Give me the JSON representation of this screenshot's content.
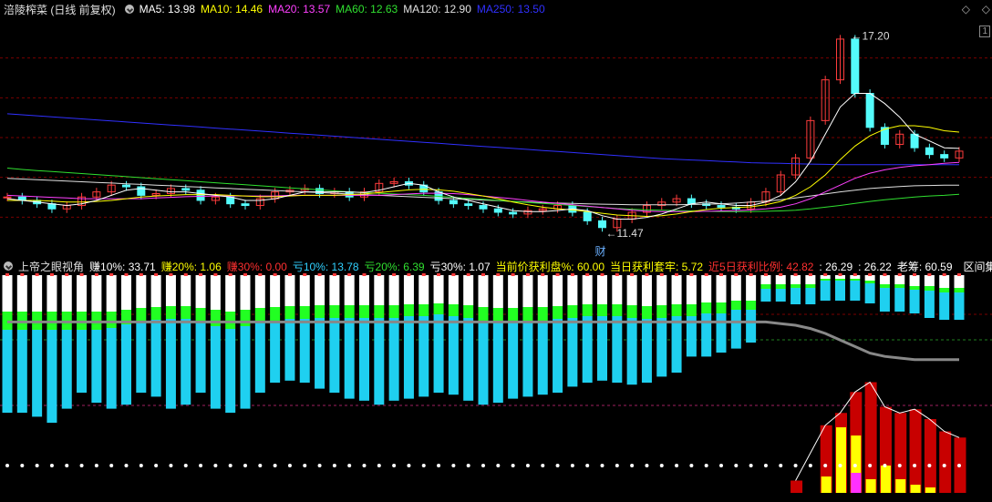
{
  "main_header": {
    "title": "涪陵榨菜 (日线 前复权)",
    "ma": [
      {
        "label": "MA5: 13.98",
        "color": "#ffffff"
      },
      {
        "label": "MA10: 14.46",
        "color": "#ffff00"
      },
      {
        "label": "MA20: 13.57",
        "color": "#ff40ff"
      },
      {
        "label": "MA60: 12.63",
        "color": "#30e030"
      },
      {
        "label": "MA120: 12.90",
        "color": "#e0e0e0"
      },
      {
        "label": "MA250: 13.50",
        "color": "#3030ff"
      }
    ]
  },
  "annotations": {
    "high": "17.20",
    "low": "11.47",
    "finance_mark": "财"
  },
  "right_controls": {
    "diamond": "◇",
    "box": "1"
  },
  "indicator_header": {
    "name": "上帝之眼视角",
    "items": [
      {
        "label": "赚10%: 33.71",
        "color": "#ffffff"
      },
      {
        "label": "赚20%: 1.06",
        "color": "#ffff00"
      },
      {
        "label": "赚30%: 0.00",
        "color": "#ff3030"
      },
      {
        "label": "亏10%: 13.78",
        "color": "#30d0ff"
      },
      {
        "label": "亏20%: 6.39",
        "color": "#30e030"
      },
      {
        "label": "亏30%: 1.07",
        "color": "#ffffff"
      },
      {
        "label": "当前价获利盘%: 60.00",
        "color": "#ffff00"
      },
      {
        "label": "当日获利套牢: 5.72",
        "color": "#ffff00"
      },
      {
        "label": "近5日获利比例: 42.82",
        "color": "#ff3030"
      },
      {
        "label": ": 26.29",
        "color": "#ffffff"
      },
      {
        "label": ": 26.22",
        "color": "#ffffff"
      },
      {
        "label": "老筹: 60.59",
        "color": "#ffffff"
      }
    ],
    "section_button": "区间集"
  },
  "colors": {
    "up": "#ff3c3c",
    "down": "#54fcfc",
    "grid": "#7a0000",
    "white_bar": "#ffffff",
    "green_bar": "#22ff22",
    "cyan_bar": "#1fd0f0",
    "red_bar": "#c80000",
    "yellow_bar": "#ffff00",
    "magenta_bar": "#ff30ff"
  },
  "chart_data": {
    "type": "candlestick",
    "ylim": [
      11.0,
      17.6
    ],
    "closes": [
      12.55,
      12.45,
      12.35,
      12.2,
      12.3,
      12.55,
      12.7,
      12.9,
      12.85,
      12.6,
      12.65,
      12.8,
      12.75,
      12.45,
      12.55,
      12.35,
      12.3,
      12.5,
      12.7,
      12.75,
      12.8,
      12.65,
      12.7,
      12.55,
      12.7,
      12.95,
      13.0,
      12.9,
      12.7,
      12.45,
      12.35,
      12.3,
      12.2,
      12.1,
      12.05,
      12.15,
      12.2,
      12.3,
      12.1,
      11.85,
      11.65,
      11.9,
      12.1,
      12.3,
      12.4,
      12.5,
      12.35,
      12.3,
      12.25,
      12.2,
      12.4,
      12.7,
      13.2,
      13.7,
      14.8,
      16.0,
      17.2,
      15.6,
      14.6,
      14.1,
      14.4,
      14.0,
      13.8,
      13.7,
      13.9
    ],
    "ma5": [
      12.5,
      12.45,
      12.4,
      12.35,
      12.3,
      12.35,
      12.45,
      12.6,
      12.75,
      12.8,
      12.75,
      12.7,
      12.7,
      12.65,
      12.6,
      12.55,
      12.45,
      12.45,
      12.5,
      12.6,
      12.7,
      12.7,
      12.7,
      12.7,
      12.68,
      12.75,
      12.85,
      12.95,
      12.9,
      12.7,
      12.55,
      12.45,
      12.35,
      12.25,
      12.15,
      12.12,
      12.12,
      12.15,
      12.2,
      12.15,
      12.0,
      11.9,
      11.9,
      11.95,
      12.05,
      12.2,
      12.35,
      12.4,
      12.35,
      12.3,
      12.3,
      12.4,
      12.6,
      13.0,
      13.6,
      14.4,
      15.2,
      15.6,
      15.6,
      15.3,
      14.9,
      14.4,
      14.2,
      14.0,
      13.98
    ],
    "ma10": [
      12.45,
      12.45,
      12.45,
      12.43,
      12.4,
      12.4,
      12.42,
      12.45,
      12.5,
      12.55,
      12.58,
      12.6,
      12.62,
      12.62,
      12.62,
      12.6,
      12.58,
      12.56,
      12.56,
      12.58,
      12.6,
      12.6,
      12.6,
      12.62,
      12.64,
      12.68,
      12.72,
      12.76,
      12.78,
      12.76,
      12.72,
      12.65,
      12.58,
      12.5,
      12.4,
      12.32,
      12.25,
      12.2,
      12.17,
      12.12,
      12.07,
      12.02,
      12.0,
      11.98,
      12.0,
      12.05,
      12.12,
      12.18,
      12.22,
      12.24,
      12.26,
      12.32,
      12.42,
      12.6,
      12.85,
      13.2,
      13.65,
      14.05,
      14.35,
      14.55,
      14.65,
      14.65,
      14.6,
      14.5,
      14.46
    ],
    "ma20": [
      12.6,
      12.58,
      12.56,
      12.54,
      12.52,
      12.5,
      12.5,
      12.5,
      12.5,
      12.5,
      12.52,
      12.54,
      12.56,
      12.57,
      12.58,
      12.58,
      12.58,
      12.58,
      12.58,
      12.6,
      12.6,
      12.6,
      12.6,
      12.6,
      12.6,
      12.6,
      12.62,
      12.64,
      12.66,
      12.66,
      12.65,
      12.62,
      12.58,
      12.54,
      12.5,
      12.45,
      12.4,
      12.36,
      12.32,
      12.28,
      12.24,
      12.2,
      12.16,
      12.13,
      12.12,
      12.12,
      12.12,
      12.13,
      12.14,
      12.15,
      12.17,
      12.2,
      12.25,
      12.35,
      12.5,
      12.7,
      12.9,
      13.1,
      13.25,
      13.35,
      13.42,
      13.47,
      13.5,
      13.54,
      13.57
    ],
    "ma60": [
      13.4,
      13.36,
      13.33,
      13.3,
      13.27,
      13.24,
      13.21,
      13.18,
      13.15,
      13.12,
      13.09,
      13.06,
      13.03,
      13.0,
      12.97,
      12.94,
      12.91,
      12.88,
      12.85,
      12.82,
      12.79,
      12.76,
      12.73,
      12.7,
      12.68,
      12.66,
      12.64,
      12.62,
      12.6,
      12.57,
      12.54,
      12.51,
      12.48,
      12.45,
      12.42,
      12.39,
      12.36,
      12.33,
      12.3,
      12.27,
      12.24,
      12.21,
      12.19,
      12.17,
      12.16,
      12.15,
      12.14,
      12.13,
      12.12,
      12.12,
      12.12,
      12.13,
      12.14,
      12.16,
      12.2,
      12.25,
      12.3,
      12.36,
      12.42,
      12.47,
      12.51,
      12.55,
      12.58,
      12.6,
      12.63
    ],
    "ma120": [
      13.1,
      13.08,
      13.06,
      13.04,
      13.02,
      13.0,
      12.98,
      12.96,
      12.94,
      12.92,
      12.9,
      12.88,
      12.86,
      12.84,
      12.82,
      12.8,
      12.78,
      12.76,
      12.74,
      12.72,
      12.7,
      12.68,
      12.66,
      12.64,
      12.62,
      12.6,
      12.58,
      12.56,
      12.54,
      12.52,
      12.5,
      12.48,
      12.46,
      12.44,
      12.42,
      12.4,
      12.38,
      12.37,
      12.36,
      12.35,
      12.34,
      12.33,
      12.32,
      12.32,
      12.32,
      12.32,
      12.33,
      12.34,
      12.35,
      12.37,
      12.4,
      12.43,
      12.47,
      12.52,
      12.58,
      12.64,
      12.7,
      12.75,
      12.8,
      12.83,
      12.86,
      12.88,
      12.89,
      12.9,
      12.9
    ],
    "ma250": [
      15.0,
      14.97,
      14.94,
      14.91,
      14.88,
      14.85,
      14.82,
      14.79,
      14.76,
      14.73,
      14.7,
      14.67,
      14.64,
      14.61,
      14.58,
      14.55,
      14.52,
      14.49,
      14.46,
      14.43,
      14.4,
      14.37,
      14.34,
      14.31,
      14.28,
      14.25,
      14.22,
      14.19,
      14.16,
      14.13,
      14.1,
      14.07,
      14.04,
      14.01,
      13.98,
      13.95,
      13.92,
      13.89,
      13.86,
      13.83,
      13.8,
      13.77,
      13.74,
      13.71,
      13.68,
      13.66,
      13.64,
      13.62,
      13.6,
      13.58,
      13.56,
      13.55,
      13.54,
      13.53,
      13.52,
      13.51,
      13.5,
      13.5,
      13.5,
      13.5,
      13.5,
      13.5,
      13.5,
      13.5,
      13.5
    ]
  },
  "indicator_data": {
    "ylim": [
      0,
      100
    ],
    "white_top": [
      40,
      40,
      40,
      40,
      40,
      40,
      40,
      40,
      38,
      36,
      35,
      34,
      34,
      36,
      38,
      40,
      38,
      36,
      35,
      34,
      34,
      33,
      33,
      33,
      33,
      33,
      33,
      32,
      32,
      31,
      32,
      33,
      35,
      36,
      36,
      35,
      35,
      34,
      33,
      32,
      32,
      32,
      33,
      34,
      33,
      32,
      32,
      30,
      30,
      28,
      28,
      10,
      10,
      10,
      10,
      4,
      4,
      4,
      6,
      10,
      10,
      12,
      12,
      14,
      14
    ],
    "green_top": [
      20,
      20,
      20,
      20,
      20,
      20,
      20,
      18,
      16,
      15,
      14,
      14,
      14,
      16,
      18,
      19,
      18,
      16,
      15,
      14,
      14,
      14,
      14,
      14,
      14,
      14,
      14,
      13,
      13,
      12,
      13,
      14,
      15,
      16,
      16,
      15,
      15,
      14,
      14,
      13,
      13,
      13,
      14,
      14,
      14,
      13,
      13,
      12,
      12,
      10,
      10,
      5,
      5,
      4,
      4,
      2,
      2,
      2,
      3,
      4,
      4,
      4,
      5,
      5,
      5
    ],
    "cyan_bottom": [
      -40,
      -40,
      -42,
      -45,
      -38,
      -30,
      -35,
      -38,
      -36,
      -30,
      -32,
      -38,
      -36,
      -30,
      -38,
      -40,
      -38,
      -30,
      -25,
      -24,
      -25,
      -28,
      -30,
      -33,
      -34,
      -36,
      -34,
      -33,
      -32,
      -30,
      -31,
      -34,
      -36,
      -35,
      -33,
      -32,
      -31,
      -30,
      -27,
      -25,
      -24,
      -25,
      -26,
      -25,
      -22,
      -20,
      -12,
      -12,
      -10,
      -8,
      -5,
      0,
      0,
      0,
      0,
      0,
      0,
      0,
      0,
      0,
      0,
      0,
      0,
      0,
      0
    ],
    "cyan_top_late": [
      0,
      0,
      0,
      0,
      0,
      0,
      0,
      0,
      0,
      0,
      0,
      0,
      0,
      0,
      0,
      0,
      0,
      0,
      0,
      0,
      0,
      0,
      0,
      0,
      0,
      0,
      0,
      0,
      0,
      0,
      0,
      0,
      0,
      0,
      0,
      0,
      0,
      0,
      0,
      0,
      0,
      0,
      0,
      0,
      0,
      0,
      0,
      0,
      0,
      0,
      0,
      -2,
      -2,
      -3,
      -3,
      -4,
      -4,
      -4,
      -4,
      -5,
      -5,
      -5,
      -6,
      -6,
      -6
    ],
    "gray_line": [
      -3,
      -3,
      -3,
      -3,
      -3,
      -3,
      -3,
      -3,
      -3,
      -3,
      -3,
      -3,
      -3,
      -3,
      -3,
      -3,
      -3,
      -3,
      -3,
      -3,
      -3,
      -3,
      -3,
      -3,
      -3,
      -3,
      -3,
      -3,
      -3,
      -3,
      -3,
      -3,
      -3,
      -3,
      -3,
      -3,
      -3,
      -3,
      -3,
      -3,
      -3,
      -3,
      -3,
      -3,
      -3,
      -3,
      -3,
      -3,
      -3,
      -3,
      -3,
      -3,
      -4,
      -5,
      -7,
      -10,
      -14,
      -18,
      -22,
      -24,
      -25,
      -26,
      -26,
      -26,
      -26
    ],
    "red_bars_late": [
      0,
      0,
      0,
      0,
      0,
      0,
      0,
      0,
      0,
      0,
      0,
      0,
      0,
      0,
      0,
      0,
      0,
      0,
      0,
      0,
      0,
      0,
      0,
      0,
      0,
      0,
      0,
      0,
      0,
      0,
      0,
      0,
      0,
      0,
      0,
      0,
      0,
      0,
      0,
      0,
      0,
      0,
      0,
      0,
      0,
      0,
      0,
      0,
      0,
      0,
      0,
      0,
      0,
      10,
      0,
      55,
      65,
      82,
      90,
      70,
      65,
      68,
      60,
      50,
      45
    ],
    "yellow_bars_late": [
      0,
      0,
      0,
      0,
      0,
      0,
      0,
      0,
      0,
      0,
      0,
      0,
      0,
      0,
      0,
      0,
      0,
      0,
      0,
      0,
      0,
      0,
      0,
      0,
      0,
      0,
      0,
      0,
      0,
      0,
      0,
      0,
      0,
      0,
      0,
      0,
      0,
      0,
      0,
      0,
      0,
      0,
      0,
      0,
      0,
      0,
      0,
      0,
      0,
      0,
      0,
      0,
      0,
      0,
      0,
      12,
      48,
      42,
      10,
      20,
      10,
      6,
      4,
      0,
      0
    ]
  }
}
